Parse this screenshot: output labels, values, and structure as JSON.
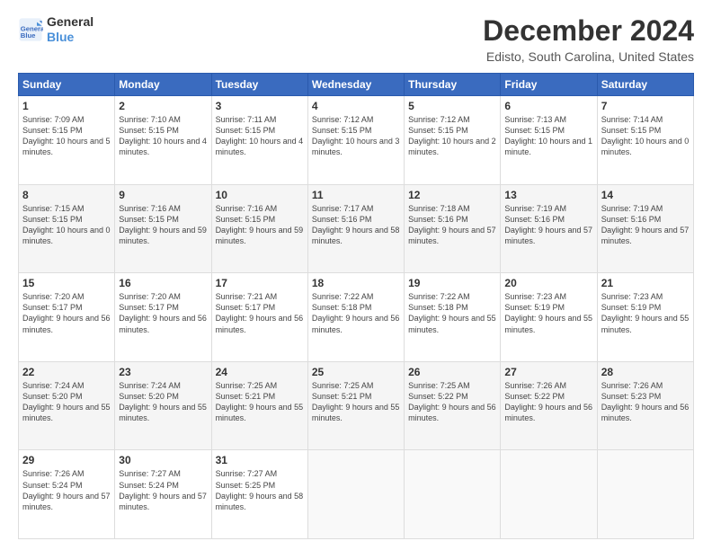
{
  "logo": {
    "line1": "General",
    "line2": "Blue"
  },
  "title": "December 2024",
  "location": "Edisto, South Carolina, United States",
  "days_header": [
    "Sunday",
    "Monday",
    "Tuesday",
    "Wednesday",
    "Thursday",
    "Friday",
    "Saturday"
  ],
  "weeks": [
    [
      {
        "day": "1",
        "sunrise": "7:09 AM",
        "sunset": "5:15 PM",
        "daylight": "10 hours and 5 minutes."
      },
      {
        "day": "2",
        "sunrise": "7:10 AM",
        "sunset": "5:15 PM",
        "daylight": "10 hours and 4 minutes."
      },
      {
        "day": "3",
        "sunrise": "7:11 AM",
        "sunset": "5:15 PM",
        "daylight": "10 hours and 4 minutes."
      },
      {
        "day": "4",
        "sunrise": "7:12 AM",
        "sunset": "5:15 PM",
        "daylight": "10 hours and 3 minutes."
      },
      {
        "day": "5",
        "sunrise": "7:12 AM",
        "sunset": "5:15 PM",
        "daylight": "10 hours and 2 minutes."
      },
      {
        "day": "6",
        "sunrise": "7:13 AM",
        "sunset": "5:15 PM",
        "daylight": "10 hours and 1 minute."
      },
      {
        "day": "7",
        "sunrise": "7:14 AM",
        "sunset": "5:15 PM",
        "daylight": "10 hours and 0 minutes."
      }
    ],
    [
      {
        "day": "8",
        "sunrise": "7:15 AM",
        "sunset": "5:15 PM",
        "daylight": "10 hours and 0 minutes."
      },
      {
        "day": "9",
        "sunrise": "7:16 AM",
        "sunset": "5:15 PM",
        "daylight": "9 hours and 59 minutes."
      },
      {
        "day": "10",
        "sunrise": "7:16 AM",
        "sunset": "5:15 PM",
        "daylight": "9 hours and 59 minutes."
      },
      {
        "day": "11",
        "sunrise": "7:17 AM",
        "sunset": "5:16 PM",
        "daylight": "9 hours and 58 minutes."
      },
      {
        "day": "12",
        "sunrise": "7:18 AM",
        "sunset": "5:16 PM",
        "daylight": "9 hours and 57 minutes."
      },
      {
        "day": "13",
        "sunrise": "7:19 AM",
        "sunset": "5:16 PM",
        "daylight": "9 hours and 57 minutes."
      },
      {
        "day": "14",
        "sunrise": "7:19 AM",
        "sunset": "5:16 PM",
        "daylight": "9 hours and 57 minutes."
      }
    ],
    [
      {
        "day": "15",
        "sunrise": "7:20 AM",
        "sunset": "5:17 PM",
        "daylight": "9 hours and 56 minutes."
      },
      {
        "day": "16",
        "sunrise": "7:20 AM",
        "sunset": "5:17 PM",
        "daylight": "9 hours and 56 minutes."
      },
      {
        "day": "17",
        "sunrise": "7:21 AM",
        "sunset": "5:17 PM",
        "daylight": "9 hours and 56 minutes."
      },
      {
        "day": "18",
        "sunrise": "7:22 AM",
        "sunset": "5:18 PM",
        "daylight": "9 hours and 56 minutes."
      },
      {
        "day": "19",
        "sunrise": "7:22 AM",
        "sunset": "5:18 PM",
        "daylight": "9 hours and 55 minutes."
      },
      {
        "day": "20",
        "sunrise": "7:23 AM",
        "sunset": "5:19 PM",
        "daylight": "9 hours and 55 minutes."
      },
      {
        "day": "21",
        "sunrise": "7:23 AM",
        "sunset": "5:19 PM",
        "daylight": "9 hours and 55 minutes."
      }
    ],
    [
      {
        "day": "22",
        "sunrise": "7:24 AM",
        "sunset": "5:20 PM",
        "daylight": "9 hours and 55 minutes."
      },
      {
        "day": "23",
        "sunrise": "7:24 AM",
        "sunset": "5:20 PM",
        "daylight": "9 hours and 55 minutes."
      },
      {
        "day": "24",
        "sunrise": "7:25 AM",
        "sunset": "5:21 PM",
        "daylight": "9 hours and 55 minutes."
      },
      {
        "day": "25",
        "sunrise": "7:25 AM",
        "sunset": "5:21 PM",
        "daylight": "9 hours and 55 minutes."
      },
      {
        "day": "26",
        "sunrise": "7:25 AM",
        "sunset": "5:22 PM",
        "daylight": "9 hours and 56 minutes."
      },
      {
        "day": "27",
        "sunrise": "7:26 AM",
        "sunset": "5:22 PM",
        "daylight": "9 hours and 56 minutes."
      },
      {
        "day": "28",
        "sunrise": "7:26 AM",
        "sunset": "5:23 PM",
        "daylight": "9 hours and 56 minutes."
      }
    ],
    [
      {
        "day": "29",
        "sunrise": "7:26 AM",
        "sunset": "5:24 PM",
        "daylight": "9 hours and 57 minutes."
      },
      {
        "day": "30",
        "sunrise": "7:27 AM",
        "sunset": "5:24 PM",
        "daylight": "9 hours and 57 minutes."
      },
      {
        "day": "31",
        "sunrise": "7:27 AM",
        "sunset": "5:25 PM",
        "daylight": "9 hours and 58 minutes."
      },
      null,
      null,
      null,
      null
    ]
  ],
  "labels": {
    "sunrise": "Sunrise:",
    "sunset": "Sunset:",
    "daylight": "Daylight:"
  }
}
